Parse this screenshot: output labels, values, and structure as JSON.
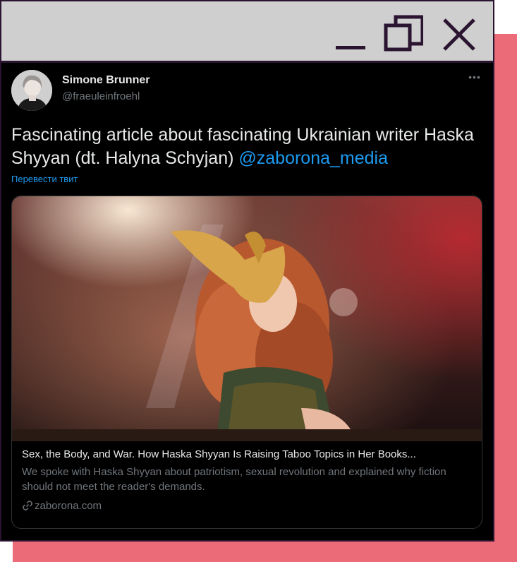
{
  "window": {
    "controls": {
      "minimize_icon": "minimize-icon",
      "maximize_icon": "restore-icon",
      "close_icon": "close-icon"
    },
    "colors": {
      "titlebar": "#cfcfcf",
      "border": "#2a1430",
      "shadow": "#ec6b78"
    }
  },
  "tweet": {
    "author": {
      "name": "Simone Brunner",
      "handle": "@fraeuleinfroehl"
    },
    "more_label": "•••",
    "text": "Fascinating article about fascinating Ukrainian writer Haska Shyyan (dt. Halyna Schyjan) ",
    "mention": "@zaborona_media",
    "translate_label": "Перевести твит",
    "card": {
      "title": "Sex, the Body, and War. How Haska Shyyan Is Raising Taboo Topics in Her Books...",
      "description": "We spoke with Haska Shyyan about patriotism, sexual revolution and explained why fiction should not meet the reader's demands.",
      "domain": "zaborona.com"
    }
  }
}
